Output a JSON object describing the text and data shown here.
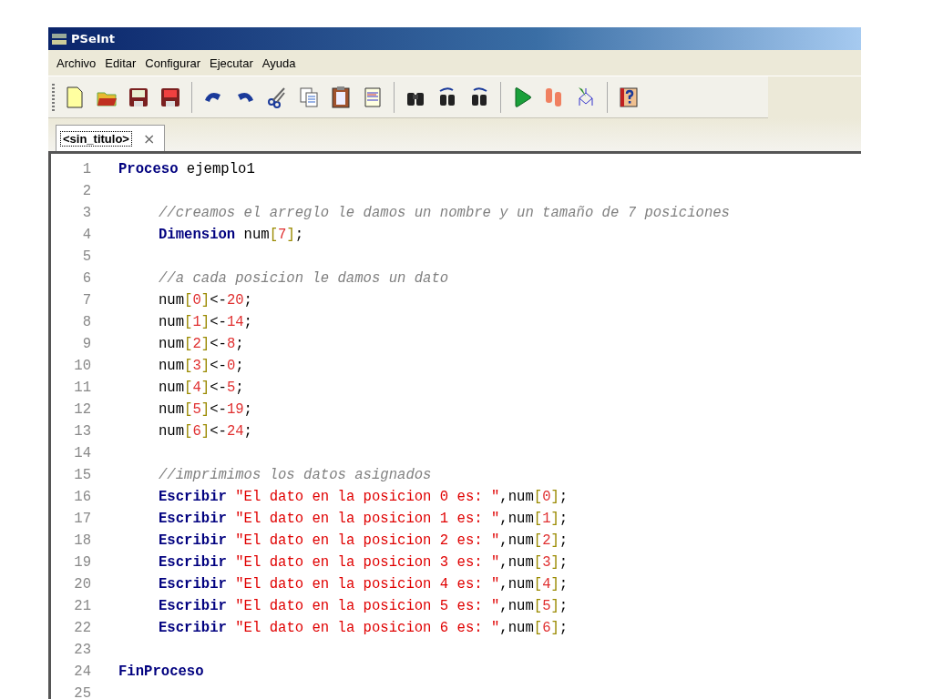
{
  "window": {
    "title": "PSeInt"
  },
  "menu": [
    "Archivo",
    "Editar",
    "Configurar",
    "Ejecutar",
    "Ayuda"
  ],
  "tabs": [
    {
      "label": "<sin_titulo>",
      "selected": true,
      "close": "×"
    }
  ],
  "editor": {
    "lines": [
      {
        "number": "1",
        "tokens": [
          {
            "kind": "keyword",
            "text": "Proceso"
          },
          {
            "kind": "ident",
            "text": " ejemplo1"
          }
        ],
        "children": [
          {
            "number": "2"
          },
          {
            "number": "3",
            "tokens": [
              {
                "kind": "comment",
                "text": "//creamos el arreglo le damos un nombre y un tamaño de 7 posiciones"
              }
            ]
          },
          {
            "number": "4",
            "tokens": [
              {
                "kind": "keyword",
                "text": "Dimension"
              },
              {
                "kind": "ident",
                "text": " num"
              },
              {
                "kind": "bracket",
                "text": "["
              },
              {
                "kind": "number",
                "text": "7"
              },
              {
                "kind": "bracket",
                "text": "]"
              },
              {
                "kind": "ident",
                "text": ";"
              }
            ]
          },
          {
            "number": "5"
          },
          {
            "number": "6",
            "tokens": [
              {
                "kind": "comment",
                "text": "//a cada posicion le damos un dato"
              }
            ]
          },
          {
            "number": "7",
            "tokens": [
              {
                "kind": "ident",
                "text": "num"
              },
              {
                "kind": "bracket",
                "text": "["
              },
              {
                "kind": "number",
                "text": "0"
              },
              {
                "kind": "bracket",
                "text": "]"
              },
              {
                "kind": "ident",
                "text": "<-"
              },
              {
                "kind": "number",
                "text": "20"
              },
              {
                "kind": "ident",
                "text": ";"
              }
            ]
          },
          {
            "number": "8",
            "tokens": [
              {
                "kind": "ident",
                "text": "num"
              },
              {
                "kind": "bracket",
                "text": "["
              },
              {
                "kind": "number",
                "text": "1"
              },
              {
                "kind": "bracket",
                "text": "]"
              },
              {
                "kind": "ident",
                "text": "<-"
              },
              {
                "kind": "number",
                "text": "14"
              },
              {
                "kind": "ident",
                "text": ";"
              }
            ]
          },
          {
            "number": "9",
            "tokens": [
              {
                "kind": "ident",
                "text": "num"
              },
              {
                "kind": "bracket",
                "text": "["
              },
              {
                "kind": "number",
                "text": "2"
              },
              {
                "kind": "bracket",
                "text": "]"
              },
              {
                "kind": "ident",
                "text": "<-"
              },
              {
                "kind": "number",
                "text": "8"
              },
              {
                "kind": "ident",
                "text": ";"
              }
            ]
          },
          {
            "number": "10",
            "tokens": [
              {
                "kind": "ident",
                "text": "num"
              },
              {
                "kind": "bracket",
                "text": "["
              },
              {
                "kind": "number",
                "text": "3"
              },
              {
                "kind": "bracket",
                "text": "]"
              },
              {
                "kind": "ident",
                "text": "<-"
              },
              {
                "kind": "number",
                "text": "0"
              },
              {
                "kind": "ident",
                "text": ";"
              }
            ]
          },
          {
            "number": "11",
            "tokens": [
              {
                "kind": "ident",
                "text": "num"
              },
              {
                "kind": "bracket",
                "text": "["
              },
              {
                "kind": "number",
                "text": "4"
              },
              {
                "kind": "bracket",
                "text": "]"
              },
              {
                "kind": "ident",
                "text": "<-"
              },
              {
                "kind": "number",
                "text": "5"
              },
              {
                "kind": "ident",
                "text": ";"
              }
            ]
          },
          {
            "number": "12",
            "tokens": [
              {
                "kind": "ident",
                "text": "num"
              },
              {
                "kind": "bracket",
                "text": "["
              },
              {
                "kind": "number",
                "text": "5"
              },
              {
                "kind": "bracket",
                "text": "]"
              },
              {
                "kind": "ident",
                "text": "<-"
              },
              {
                "kind": "number",
                "text": "19"
              },
              {
                "kind": "ident",
                "text": ";"
              }
            ]
          },
          {
            "number": "13",
            "tokens": [
              {
                "kind": "ident",
                "text": "num"
              },
              {
                "kind": "bracket",
                "text": "["
              },
              {
                "kind": "number",
                "text": "6"
              },
              {
                "kind": "bracket",
                "text": "]"
              },
              {
                "kind": "ident",
                "text": "<-"
              },
              {
                "kind": "number",
                "text": "24"
              },
              {
                "kind": "ident",
                "text": ";"
              }
            ]
          },
          {
            "number": "14"
          },
          {
            "number": "15",
            "tokens": [
              {
                "kind": "comment",
                "text": "//imprimimos los datos asignados"
              }
            ]
          },
          {
            "number": "16",
            "tokens": [
              {
                "kind": "keyword",
                "text": "Escribir"
              },
              {
                "kind": "string",
                "text": " \"El dato en la posicion 0 es: \""
              },
              {
                "kind": "ident",
                "text": ",num"
              },
              {
                "kind": "bracket",
                "text": "["
              },
              {
                "kind": "number",
                "text": "0"
              },
              {
                "kind": "bracket",
                "text": "]"
              },
              {
                "kind": "ident",
                "text": ";"
              }
            ]
          },
          {
            "number": "17",
            "tokens": [
              {
                "kind": "keyword",
                "text": "Escribir"
              },
              {
                "kind": "string",
                "text": " \"El dato en la posicion 1 es: \""
              },
              {
                "kind": "ident",
                "text": ",num"
              },
              {
                "kind": "bracket",
                "text": "["
              },
              {
                "kind": "number",
                "text": "1"
              },
              {
                "kind": "bracket",
                "text": "]"
              },
              {
                "kind": "ident",
                "text": ";"
              }
            ]
          },
          {
            "number": "18",
            "tokens": [
              {
                "kind": "keyword",
                "text": "Escribir"
              },
              {
                "kind": "string",
                "text": " \"El dato en la posicion 2 es: \""
              },
              {
                "kind": "ident",
                "text": ",num"
              },
              {
                "kind": "bracket",
                "text": "["
              },
              {
                "kind": "number",
                "text": "2"
              },
              {
                "kind": "bracket",
                "text": "]"
              },
              {
                "kind": "ident",
                "text": ";"
              }
            ]
          },
          {
            "number": "19",
            "tokens": [
              {
                "kind": "keyword",
                "text": "Escribir"
              },
              {
                "kind": "string",
                "text": " \"El dato en la posicion 3 es: \""
              },
              {
                "kind": "ident",
                "text": ",num"
              },
              {
                "kind": "bracket",
                "text": "["
              },
              {
                "kind": "number",
                "text": "3"
              },
              {
                "kind": "bracket",
                "text": "]"
              },
              {
                "kind": "ident",
                "text": ";"
              }
            ]
          },
          {
            "number": "20",
            "tokens": [
              {
                "kind": "keyword",
                "text": "Escribir"
              },
              {
                "kind": "string",
                "text": " \"El dato en la posicion 4 es: \""
              },
              {
                "kind": "ident",
                "text": ",num"
              },
              {
                "kind": "bracket",
                "text": "["
              },
              {
                "kind": "number",
                "text": "4"
              },
              {
                "kind": "bracket",
                "text": "]"
              },
              {
                "kind": "ident",
                "text": ";"
              }
            ]
          },
          {
            "number": "21",
            "tokens": [
              {
                "kind": "keyword",
                "text": "Escribir"
              },
              {
                "kind": "string",
                "text": " \"El dato en la posicion 5 es: \""
              },
              {
                "kind": "ident",
                "text": ",num"
              },
              {
                "kind": "bracket",
                "text": "["
              },
              {
                "kind": "number",
                "text": "5"
              },
              {
                "kind": "bracket",
                "text": "]"
              },
              {
                "kind": "ident",
                "text": ";"
              }
            ]
          },
          {
            "number": "22",
            "tokens": [
              {
                "kind": "keyword",
                "text": "Escribir"
              },
              {
                "kind": "string",
                "text": " \"El dato en la posicion 6 es: \""
              },
              {
                "kind": "ident",
                "text": ",num"
              },
              {
                "kind": "bracket",
                "text": "["
              },
              {
                "kind": "number",
                "text": "6"
              },
              {
                "kind": "bracket",
                "text": "]"
              },
              {
                "kind": "ident",
                "text": ";"
              }
            ]
          },
          {
            "number": "23"
          }
        ]
      },
      {
        "number": "24",
        "tokens": [
          {
            "kind": "keyword",
            "text": "FinProceso"
          }
        ]
      },
      {
        "number": "25"
      }
    ]
  }
}
